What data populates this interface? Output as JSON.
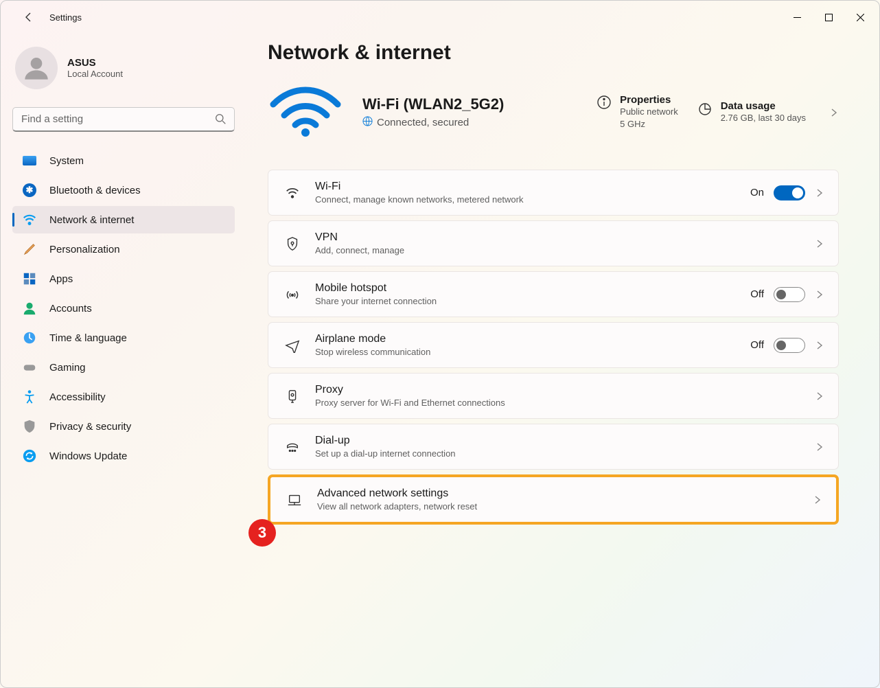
{
  "window": {
    "title": "Settings"
  },
  "profile": {
    "name": "ASUS",
    "sub": "Local Account"
  },
  "search": {
    "placeholder": "Find a setting"
  },
  "sidebar": {
    "items": [
      {
        "label": "System"
      },
      {
        "label": "Bluetooth & devices"
      },
      {
        "label": "Network & internet"
      },
      {
        "label": "Personalization"
      },
      {
        "label": "Apps"
      },
      {
        "label": "Accounts"
      },
      {
        "label": "Time & language"
      },
      {
        "label": "Gaming"
      },
      {
        "label": "Accessibility"
      },
      {
        "label": "Privacy & security"
      },
      {
        "label": "Windows Update"
      }
    ]
  },
  "page": {
    "title": "Network & internet",
    "hero": {
      "ssid": "Wi-Fi (WLAN2_5G2)",
      "status": "Connected, secured",
      "properties": {
        "label": "Properties",
        "sub1": "Public network",
        "sub2": "5 GHz"
      },
      "usage": {
        "label": "Data usage",
        "sub": "2.76 GB, last 30 days"
      }
    },
    "cards": {
      "wifi": {
        "title": "Wi-Fi",
        "sub": "Connect, manage known networks, metered network",
        "toggle_label": "On",
        "on": true
      },
      "vpn": {
        "title": "VPN",
        "sub": "Add, connect, manage"
      },
      "hotspot": {
        "title": "Mobile hotspot",
        "sub": "Share your internet connection",
        "toggle_label": "Off",
        "on": false
      },
      "airplane": {
        "title": "Airplane mode",
        "sub": "Stop wireless communication",
        "toggle_label": "Off",
        "on": false
      },
      "proxy": {
        "title": "Proxy",
        "sub": "Proxy server for Wi-Fi and Ethernet connections"
      },
      "dialup": {
        "title": "Dial-up",
        "sub": "Set up a dial-up internet connection"
      },
      "advanced": {
        "title": "Advanced network settings",
        "sub": "View all network adapters, network reset"
      }
    }
  },
  "annotation": {
    "badge": "3"
  }
}
